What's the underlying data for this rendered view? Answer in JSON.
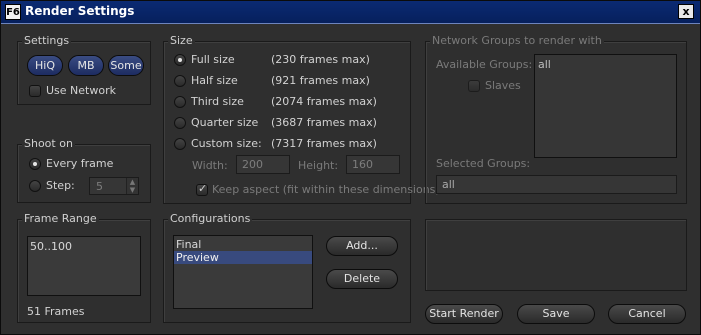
{
  "window": {
    "icon_text": "F6",
    "title": "Render Settings",
    "close_glyph": "x"
  },
  "settings": {
    "label": "Settings",
    "buttons": [
      "HiQ",
      "MB",
      "Some"
    ],
    "use_network": "Use Network"
  },
  "shoot_on": {
    "label": "Shoot on",
    "every_frame": "Every frame",
    "step": "Step:",
    "step_value": "5"
  },
  "frame_range": {
    "label": "Frame Range",
    "value": "50..100",
    "count": "51 Frames"
  },
  "size": {
    "label": "Size",
    "options": [
      {
        "name": "Full size",
        "max": "(230 frames max)"
      },
      {
        "name": "Half size",
        "max": "(921 frames max)"
      },
      {
        "name": "Third size",
        "max": "(2074 frames max)"
      },
      {
        "name": "Quarter size",
        "max": "(3687 frames max)"
      },
      {
        "name": "Custom size:",
        "max": "(7317 frames max)"
      }
    ],
    "width_label": "Width:",
    "width_value": "200",
    "height_label": "Height:",
    "height_value": "160",
    "keep_aspect": "Keep aspect (fit within these dimensions)"
  },
  "configurations": {
    "label": "Configurations",
    "items": [
      "Final",
      "Preview"
    ],
    "add": "Add...",
    "delete": "Delete"
  },
  "network": {
    "label": "Network Groups to render with",
    "available_label": "Available Groups:",
    "available_value": "all",
    "slaves": "Slaves",
    "selected_label": "Selected Groups:",
    "selected_value": "all"
  },
  "actions": {
    "start": "Start Render",
    "save": "Save",
    "cancel": "Cancel"
  }
}
